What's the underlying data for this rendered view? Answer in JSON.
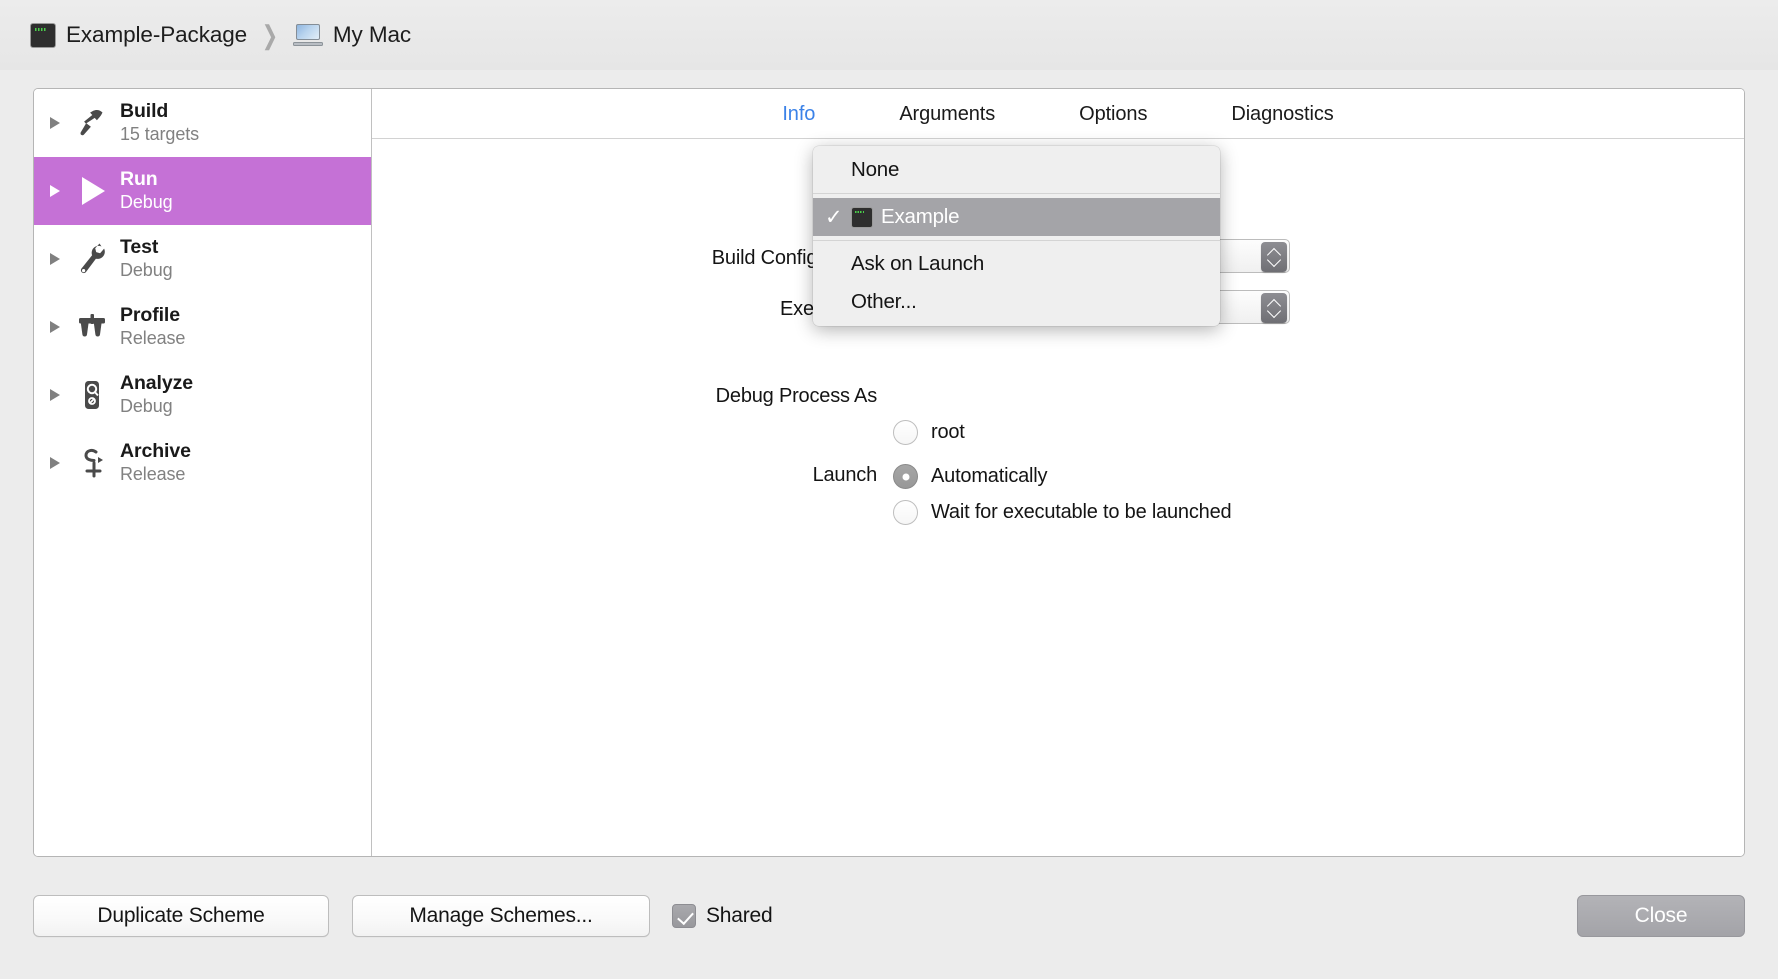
{
  "window": {
    "breadcrumb": [
      {
        "icon": "terminal-icon",
        "label": "Example-Package"
      },
      {
        "icon": "laptop-icon",
        "label": "My Mac"
      }
    ],
    "separator": "❯"
  },
  "sidebar": {
    "items": [
      {
        "title": "Build",
        "subtitle": "15 targets",
        "icon": "hammer-icon",
        "selected": false
      },
      {
        "title": "Run",
        "subtitle": "Debug",
        "icon": "play-icon",
        "selected": true
      },
      {
        "title": "Test",
        "subtitle": "Debug",
        "icon": "wrench-icon",
        "selected": false
      },
      {
        "title": "Profile",
        "subtitle": "Release",
        "icon": "calipers-icon",
        "selected": false
      },
      {
        "title": "Analyze",
        "subtitle": "Debug",
        "icon": "magnifier-icon",
        "selected": false
      },
      {
        "title": "Archive",
        "subtitle": "Release",
        "icon": "archive-icon",
        "selected": false
      }
    ]
  },
  "detail": {
    "tabs": [
      {
        "label": "Info",
        "active": true
      },
      {
        "label": "Arguments",
        "active": false
      },
      {
        "label": "Options",
        "active": false
      },
      {
        "label": "Diagnostics",
        "active": false
      }
    ],
    "fields": {
      "build_configuration_label": "Build Configuration",
      "executable_label": "Executable",
      "debug_process_as_label": "Debug Process As",
      "launch_label": "Launch"
    },
    "debug_process_as": {
      "options": [
        {
          "label": "root",
          "selected": false
        }
      ]
    },
    "launch": {
      "options": [
        {
          "label": "Automatically",
          "selected": true
        },
        {
          "label": "Wait for executable to be launched",
          "selected": false
        }
      ]
    }
  },
  "menu": {
    "items": [
      {
        "label": "None",
        "checked": false,
        "icon": null,
        "highlighted": false,
        "separator_after": true
      },
      {
        "label": "Example",
        "checked": true,
        "icon": "terminal-icon",
        "highlighted": true,
        "separator_after": true
      },
      {
        "label": "Ask on Launch",
        "checked": false,
        "icon": null,
        "highlighted": false,
        "separator_after": false
      },
      {
        "label": "Other...",
        "checked": false,
        "icon": null,
        "highlighted": false,
        "separator_after": false
      }
    ],
    "check_glyph": "✓"
  },
  "bottom": {
    "duplicate_scheme_label": "Duplicate Scheme",
    "manage_schemes_label": "Manage Schemes...",
    "shared_label": "Shared",
    "shared_checked": true,
    "close_label": "Close"
  },
  "colors": {
    "selection": "#c571d6",
    "active_tab": "#3b82e8",
    "menu_highlight": "#a4a4a8",
    "window_bg": "#ececec"
  }
}
